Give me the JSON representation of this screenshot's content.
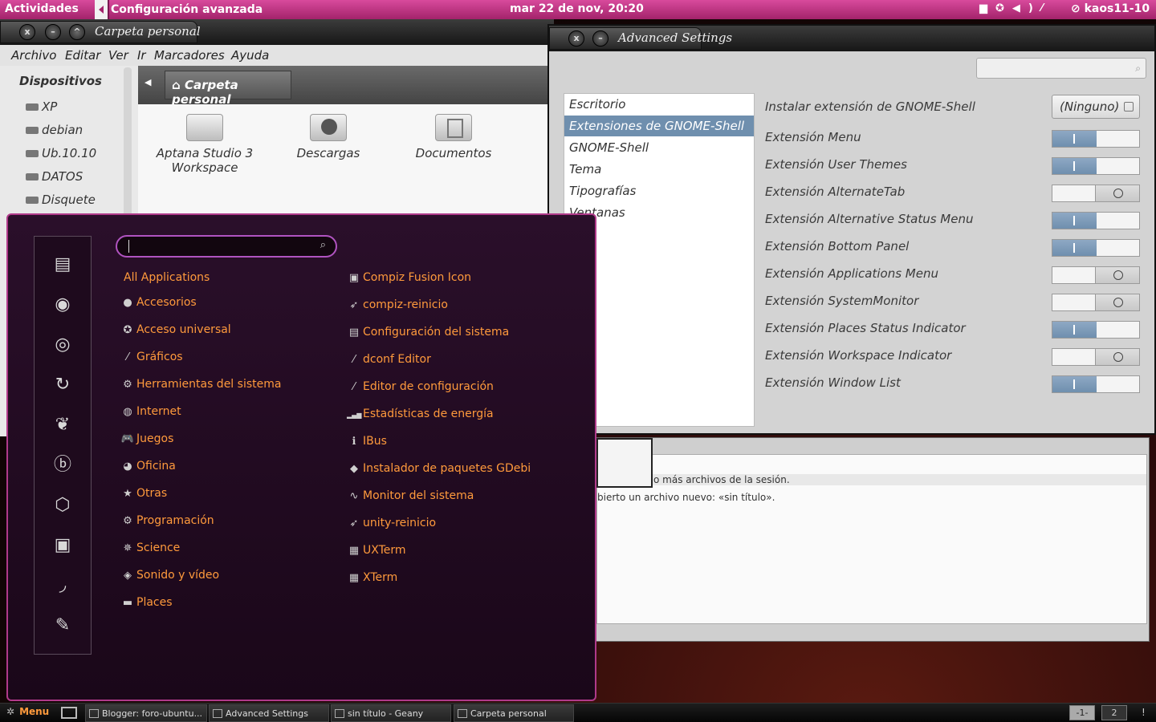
{
  "top_panel": {
    "activities": "Actividades",
    "app_menu": "Configuración avanzada",
    "clock": "mar 22 de nov, 20:20",
    "tray_icons": [
      "folder-icon",
      "accessibility-icon",
      "volume-icon",
      "tools-icon"
    ],
    "user": "kaos11-10"
  },
  "nautilus": {
    "title": "Carpeta personal",
    "menus": [
      "Archivo",
      "Editar",
      "Ver",
      "Ir",
      "Marcadores",
      "Ayuda"
    ],
    "sidebar_heading": "Dispositivos",
    "devices": [
      "XP",
      "debian",
      "Ub.10.10",
      "DATOS",
      "Disquete"
    ],
    "breadcrumb": "Carpeta personal",
    "files": [
      {
        "name_line1": "Aptana Studio 3",
        "name_line2": "Workspace",
        "icon": "folder-icon"
      },
      {
        "name_line1": "Descargas",
        "name_line2": "",
        "icon": "downloads-folder-icon"
      },
      {
        "name_line1": "Documentos",
        "name_line2": "",
        "icon": "documents-folder-icon"
      }
    ]
  },
  "advanced_settings": {
    "title": "Advanced Settings",
    "search_placeholder": "",
    "categories": [
      {
        "label": "Escritorio",
        "selected": false
      },
      {
        "label": "Extensiones de GNOME-Shell",
        "selected": true
      },
      {
        "label": "GNOME-Shell",
        "selected": false
      },
      {
        "label": "Tema",
        "selected": false
      },
      {
        "label": "Tipografías",
        "selected": false
      },
      {
        "label": "Ventanas",
        "selected": false
      }
    ],
    "install_label": "Instalar extensión de GNOME-Shell",
    "install_value": "(Ninguno)",
    "extensions": [
      {
        "label": "Extensión Menu",
        "enabled": true
      },
      {
        "label": "Extensión User Themes",
        "enabled": true
      },
      {
        "label": "Extensión AlternateTab",
        "enabled": false
      },
      {
        "label": "Extensión Alternative Status Menu",
        "enabled": true
      },
      {
        "label": "Extensión Bottom Panel",
        "enabled": true
      },
      {
        "label": "Extensión Applications Menu",
        "enabled": false
      },
      {
        "label": "Extensión SystemMonitor",
        "enabled": false
      },
      {
        "label": "Extensión Places Status Indicator",
        "enabled": true
      },
      {
        "label": "Extensión Workspace Indicator",
        "enabled": false
      },
      {
        "label": "Extensión Window List",
        "enabled": true
      }
    ]
  },
  "geany": {
    "messages": [
      "o más archivos de la sesión.",
      "bierto un archivo nuevo: «sin título»."
    ]
  },
  "app_menu": {
    "search_value": "",
    "favorites": [
      "files-icon",
      "firefox-icon",
      "chrome-icon",
      "refresh-icon",
      "pidgin-icon",
      "blender-icon",
      "fan-icon",
      "screenshot-icon",
      "bird-icon",
      "pen-icon"
    ],
    "categories": [
      {
        "label": "All Applications",
        "icon": ""
      },
      {
        "label": "Accesorios",
        "icon": "●"
      },
      {
        "label": "Acceso universal",
        "icon": "✪"
      },
      {
        "label": "Gráficos",
        "icon": "⁄"
      },
      {
        "label": "Herramientas del sistema",
        "icon": "⚙"
      },
      {
        "label": "Internet",
        "icon": "◍"
      },
      {
        "label": "Juegos",
        "icon": "🎮"
      },
      {
        "label": "Oficina",
        "icon": "◕"
      },
      {
        "label": "Otras",
        "icon": "★"
      },
      {
        "label": "Programación",
        "icon": "⚙"
      },
      {
        "label": "Science",
        "icon": "✵"
      },
      {
        "label": "Sonido y vídeo",
        "icon": "◈"
      },
      {
        "label": "Places",
        "icon": "▬"
      }
    ],
    "apps": [
      {
        "label": "Compiz Fusion Icon",
        "icon": "▣"
      },
      {
        "label": "compiz-reinicio",
        "icon": "➶"
      },
      {
        "label": "Configuración del sistema",
        "icon": "▤"
      },
      {
        "label": "dconf Editor",
        "icon": "⁄"
      },
      {
        "label": "Editor de configuración",
        "icon": "⁄"
      },
      {
        "label": "Estadísticas de energía",
        "icon": "▂▄▆"
      },
      {
        "label": "IBus",
        "icon": "ℹ"
      },
      {
        "label": "Instalador de paquetes GDebi",
        "icon": "◆"
      },
      {
        "label": "Monitor del sistema",
        "icon": "∿"
      },
      {
        "label": "unity-reinicio",
        "icon": "➶"
      },
      {
        "label": "UXTerm",
        "icon": "▦"
      },
      {
        "label": "XTerm",
        "icon": "▦"
      }
    ]
  },
  "bottom_panel": {
    "menu_label": "Menu",
    "tasks": [
      {
        "label": "Blogger: foro-ubuntu..."
      },
      {
        "label": "Advanced Settings"
      },
      {
        "label": "sin título - Geany"
      },
      {
        "label": "Carpeta personal"
      }
    ],
    "workspaces": [
      "-1-",
      "2"
    ],
    "end_glyph": "!"
  }
}
